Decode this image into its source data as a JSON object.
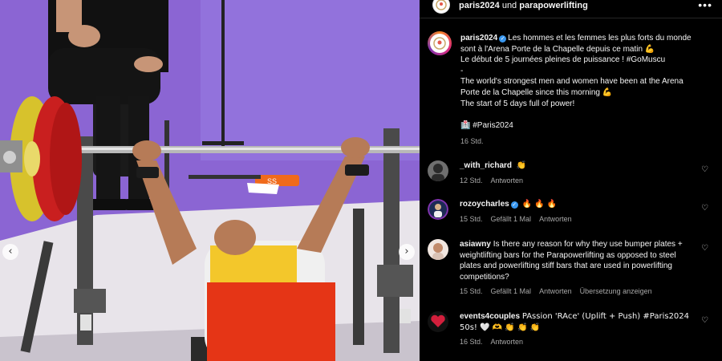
{
  "photo": {
    "prev_label": "‹",
    "next_label": "›",
    "plate_label": "SS"
  },
  "header": {
    "account": "paris2024",
    "connector": " und ",
    "collaborator": "parapowerlifting",
    "more_label": "•••"
  },
  "caption": {
    "username": "paris2024",
    "lines": [
      "Les hommes et les femmes les plus forts du monde",
      "sont à l'Arena Porte de la Chapelle depuis ce matin 💪",
      "Le début de 5 journées pleines de puissance ! #GoMuscu",
      "-",
      "The world's strongest men and women have been at the Arena",
      "Porte de la Chapelle since this morning 💪",
      "The start of 5 days full of power!",
      "",
      "🏥 #Paris2024"
    ],
    "time": "16 Std."
  },
  "comments": [
    {
      "username": "_with_richard",
      "text": "👏",
      "time": "12 Std.",
      "likes": "",
      "reply": "Antworten",
      "translate": "",
      "verified": false
    },
    {
      "username": "rozoycharles",
      "text": "🔥 🔥 🔥",
      "time": "15 Std.",
      "likes": "Gefällt 1 Mal",
      "reply": "Antworten",
      "translate": "",
      "verified": true
    },
    {
      "username": "asiawny",
      "text": "Is there any reason for why they use bumper plates + weightlifting bars for the Parapowerlifting as opposed to steel plates and powerlifting stiff bars that are used in powerlifting competitions?",
      "time": "15 Std.",
      "likes": "Gefällt 1 Mal",
      "reply": "Antworten",
      "translate": "Übersetzung anzeigen",
      "verified": false
    },
    {
      "username": "events4couples",
      "text": "PAssion 'RAce' (Uplift + Push) #Paris2024 50s! 🤍 🫶 👏 👏 👏",
      "time": "16 Std.",
      "likes": "",
      "reply": "Antworten",
      "translate": "",
      "verified": false
    }
  ],
  "icons": {
    "heart": "♡",
    "verified": "✓"
  },
  "colors": {
    "background": "#000000",
    "text": "#f5f5f5",
    "muted": "#a8a8a8",
    "verified": "#3897f0",
    "floor_purple": "#8a63d2"
  }
}
